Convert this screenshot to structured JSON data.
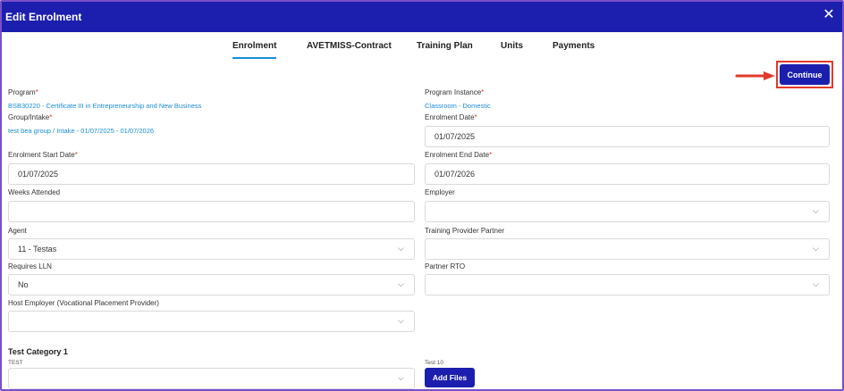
{
  "header": {
    "title": "Edit Enrolment",
    "close_glyph": "✕"
  },
  "tabs": [
    {
      "label": "Enrolment",
      "active": true
    },
    {
      "label": "AVETMISS-Contract",
      "active": false
    },
    {
      "label": "Training Plan",
      "active": false
    },
    {
      "label": "Units",
      "active": false
    },
    {
      "label": "Payments",
      "active": false
    }
  ],
  "continue_label": "Continue",
  "form": {
    "program": {
      "label": "Program",
      "value": "BSB30220 - Certificate III in Entrepreneurship and New Business"
    },
    "program_instance": {
      "label": "Program Instance",
      "value": "Classroom - Domestic"
    },
    "group_intake": {
      "label": "Group/Intake",
      "value": "test bea group / Intake - 01/07/2025 - 01/07/2026"
    },
    "enrolment_date": {
      "label": "Enrolment Date",
      "value": "01/07/2025"
    },
    "enrolment_start_date": {
      "label": "Enrolment Start Date",
      "value": "01/07/2025"
    },
    "enrolment_end_date": {
      "label": "Enrolment End Date",
      "value": "01/07/2026"
    },
    "weeks_attended": {
      "label": "Weeks Attended",
      "value": ""
    },
    "employer": {
      "label": "Employer",
      "value": ""
    },
    "agent": {
      "label": "Agent",
      "value": "11 - Testas"
    },
    "training_provider_partner": {
      "label": "Training Provider Partner",
      "value": ""
    },
    "requires_lln": {
      "label": "Requires LLN",
      "value": "No"
    },
    "partner_rto": {
      "label": "Partner RTO",
      "value": ""
    },
    "host_employer": {
      "label": "Host Employer (Vocational Placement Provider)",
      "value": ""
    }
  },
  "test_category": {
    "title": "Test Category 1",
    "test_label": "TEST",
    "test10_label": "Test 10",
    "add_files_label": "Add Files"
  },
  "required_marker": "*",
  "colors": {
    "header": "#1c1fad",
    "accent": "#1a8cd8",
    "required": "#e03a2b"
  },
  "icons": {
    "chevron": "chevron-down-icon",
    "close": "close-icon",
    "arrow": "arrow-right-icon"
  }
}
